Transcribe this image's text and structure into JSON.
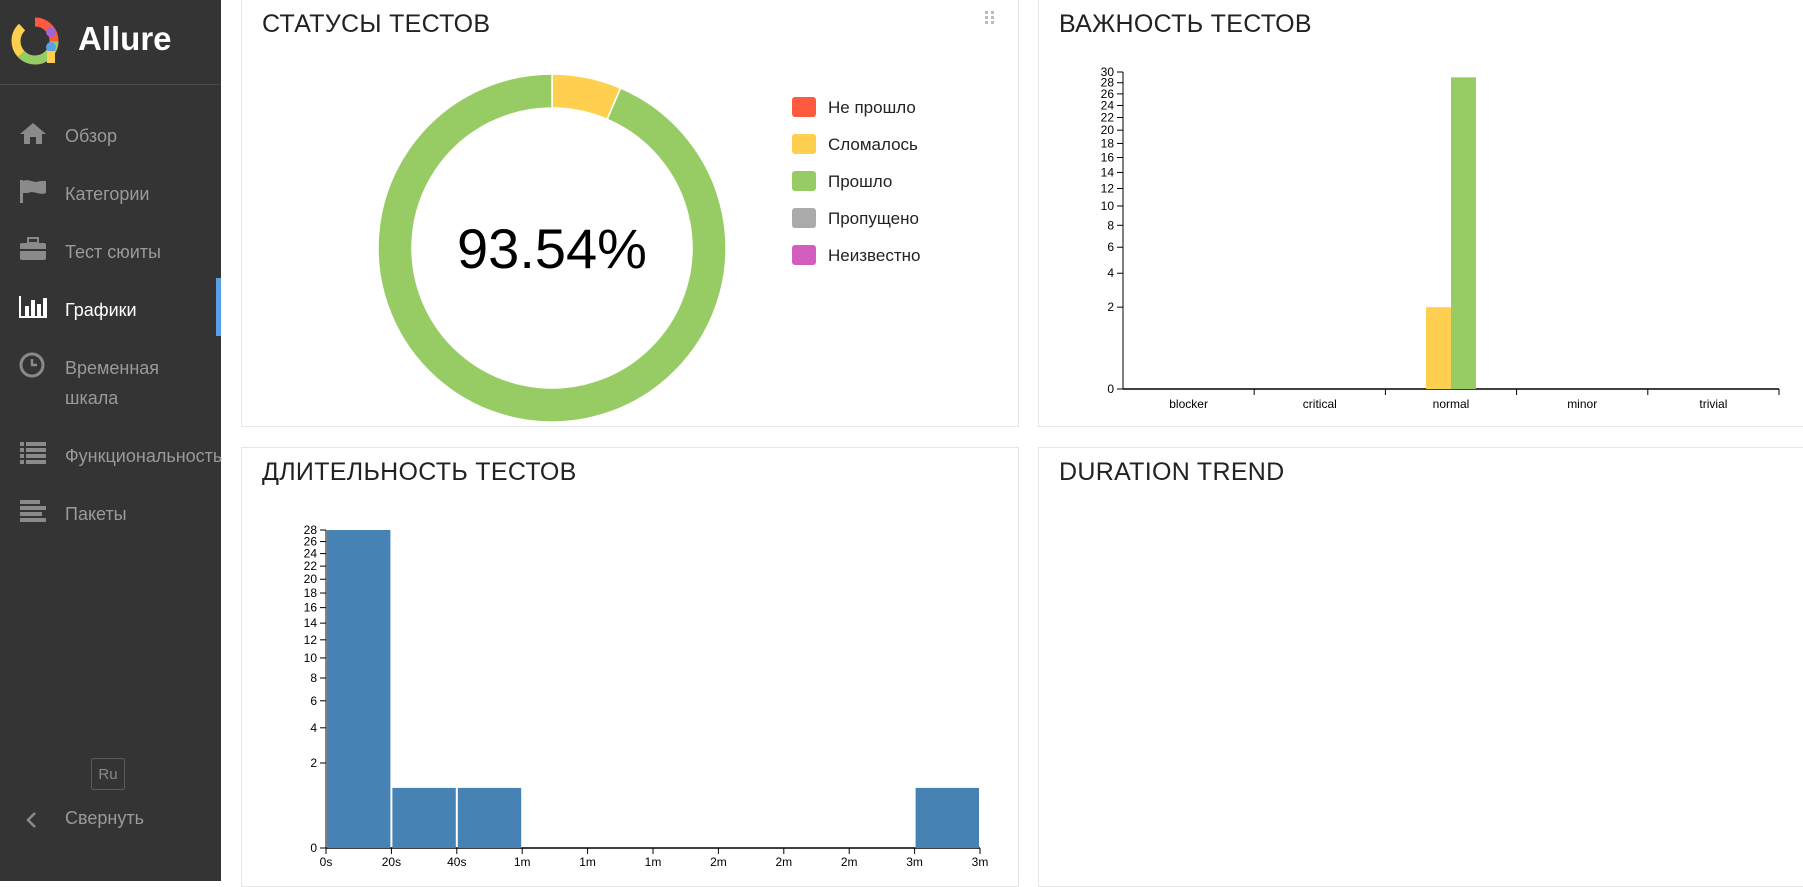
{
  "app": {
    "name": "Allure"
  },
  "sidebar": {
    "items": [
      {
        "label": "Обзор",
        "icon": "home-icon",
        "active": false
      },
      {
        "label": "Категории",
        "icon": "flag-icon",
        "active": false
      },
      {
        "label": "Тест сюиты",
        "icon": "briefcase-icon",
        "active": false
      },
      {
        "label": "Графики",
        "icon": "bar-chart-icon",
        "active": true
      },
      {
        "label": "Временная шкала",
        "icon": "clock-icon",
        "active": false
      },
      {
        "label": "Функциональность",
        "icon": "list-icon",
        "active": false
      },
      {
        "label": "Пакеты",
        "icon": "align-left-icon",
        "active": false
      }
    ],
    "language": "Ru",
    "collapse_label": "Свернуть"
  },
  "panels": {
    "statuses": {
      "title": "СТАТУСЫ ТЕСТОВ",
      "center_value": "93.54%",
      "legend": [
        {
          "label": "Не прошло",
          "color": "#fd5a3e"
        },
        {
          "label": "Сломалось",
          "color": "#ffd050"
        },
        {
          "label": "Прошло",
          "color": "#97cc64"
        },
        {
          "label": "Пропущено",
          "color": "#aaaaaa"
        },
        {
          "label": "Неизвестно",
          "color": "#d35ebe"
        }
      ]
    },
    "severity": {
      "title": "ВАЖНОСТЬ ТЕСТОВ"
    },
    "duration": {
      "title": "ДЛИТЕЛЬНОСТЬ ТЕСТОВ"
    },
    "duration_trend": {
      "title": "DURATION TREND"
    }
  },
  "chart_data": [
    {
      "type": "pie",
      "title": "СТАТУСЫ ТЕСТОВ",
      "categories": [
        "Не прошло",
        "Сломалось",
        "Прошло",
        "Пропущено",
        "Неизвестно"
      ],
      "values": [
        0,
        2,
        29,
        0,
        0
      ],
      "colors": [
        "#fd5a3e",
        "#ffd050",
        "#97cc64",
        "#aaaaaa",
        "#d35ebe"
      ],
      "center_label": "93.54%",
      "legend": "right"
    },
    {
      "type": "bar",
      "title": "ВАЖНОСТЬ ТЕСТОВ",
      "categories": [
        "blocker",
        "critical",
        "normal",
        "minor",
        "trivial"
      ],
      "series": [
        {
          "values": [
            0,
            0,
            2,
            0,
            0
          ],
          "color": "#ffd050"
        },
        {
          "values": [
            0,
            0,
            29,
            0,
            0
          ],
          "color": "#97cc64"
        }
      ],
      "yscale": "sqrt",
      "yticks": [
        0,
        2,
        4,
        6,
        8,
        10,
        12,
        14,
        16,
        18,
        20,
        22,
        24,
        26,
        28,
        30
      ],
      "ylim": [
        0,
        30
      ]
    },
    {
      "type": "bar",
      "title": "ДЛИТЕЛЬНОСТЬ ТЕСТОВ",
      "xticks": [
        "0s",
        "20s",
        "40s",
        "1m",
        "1m",
        "1m",
        "2m",
        "2m",
        "2m",
        "3m",
        "3m"
      ],
      "values": [
        28,
        1,
        1,
        0,
        0,
        0,
        0,
        0,
        0,
        1
      ],
      "color": "#4682b4",
      "yscale": "sqrt",
      "yticks": [
        0,
        2,
        4,
        6,
        8,
        10,
        12,
        14,
        16,
        18,
        20,
        22,
        24,
        26,
        28
      ],
      "ylim": [
        0,
        28
      ]
    }
  ]
}
